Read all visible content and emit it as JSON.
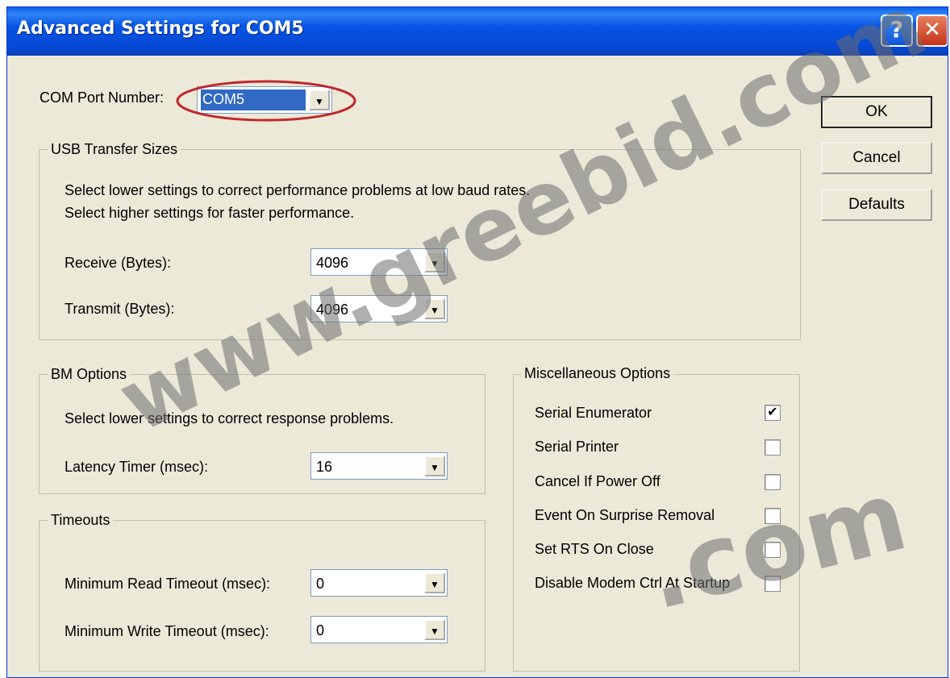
{
  "window": {
    "title": "Advanced Settings for COM5",
    "help_glyph": "?",
    "close_glyph": "✕"
  },
  "com_port": {
    "label": "COM Port Number:",
    "value": "COM5"
  },
  "buttons": {
    "ok": "OK",
    "cancel": "Cancel",
    "defaults": "Defaults"
  },
  "usb_transfer": {
    "legend": "USB Transfer Sizes",
    "desc1": "Select lower settings to correct performance problems at low baud rates.",
    "desc2": "Select higher settings for faster performance.",
    "receive_label": "Receive (Bytes):",
    "receive_value": "4096",
    "transmit_label": "Transmit (Bytes):",
    "transmit_value": "4096"
  },
  "bm_options": {
    "legend": "BM Options",
    "desc": "Select lower settings to correct response problems.",
    "latency_label": "Latency Timer (msec):",
    "latency_value": "16"
  },
  "timeouts": {
    "legend": "Timeouts",
    "read_label": "Minimum Read Timeout (msec):",
    "read_value": "0",
    "write_label": "Minimum Write Timeout (msec):",
    "write_value": "0"
  },
  "misc": {
    "legend": "Miscellaneous Options",
    "items": [
      {
        "label": "Serial Enumerator",
        "checked": true
      },
      {
        "label": "Serial Printer",
        "checked": false
      },
      {
        "label": "Cancel If Power Off",
        "checked": false
      },
      {
        "label": "Event On Surprise Removal",
        "checked": false
      },
      {
        "label": "Set RTS On Close",
        "checked": false
      },
      {
        "label": "Disable Modem Ctrl At Startup",
        "checked": false
      }
    ]
  },
  "icons": {
    "dropdown": "▼",
    "checkmark": "✔"
  },
  "watermark": {
    "main": "www.greebid.com",
    "bottom": ".com"
  },
  "colors": {
    "title_bar": "#0754e3",
    "dialog_bg": "#ece9d8",
    "highlight": "#316ac5",
    "annotation_ellipse": "#c0282d"
  }
}
